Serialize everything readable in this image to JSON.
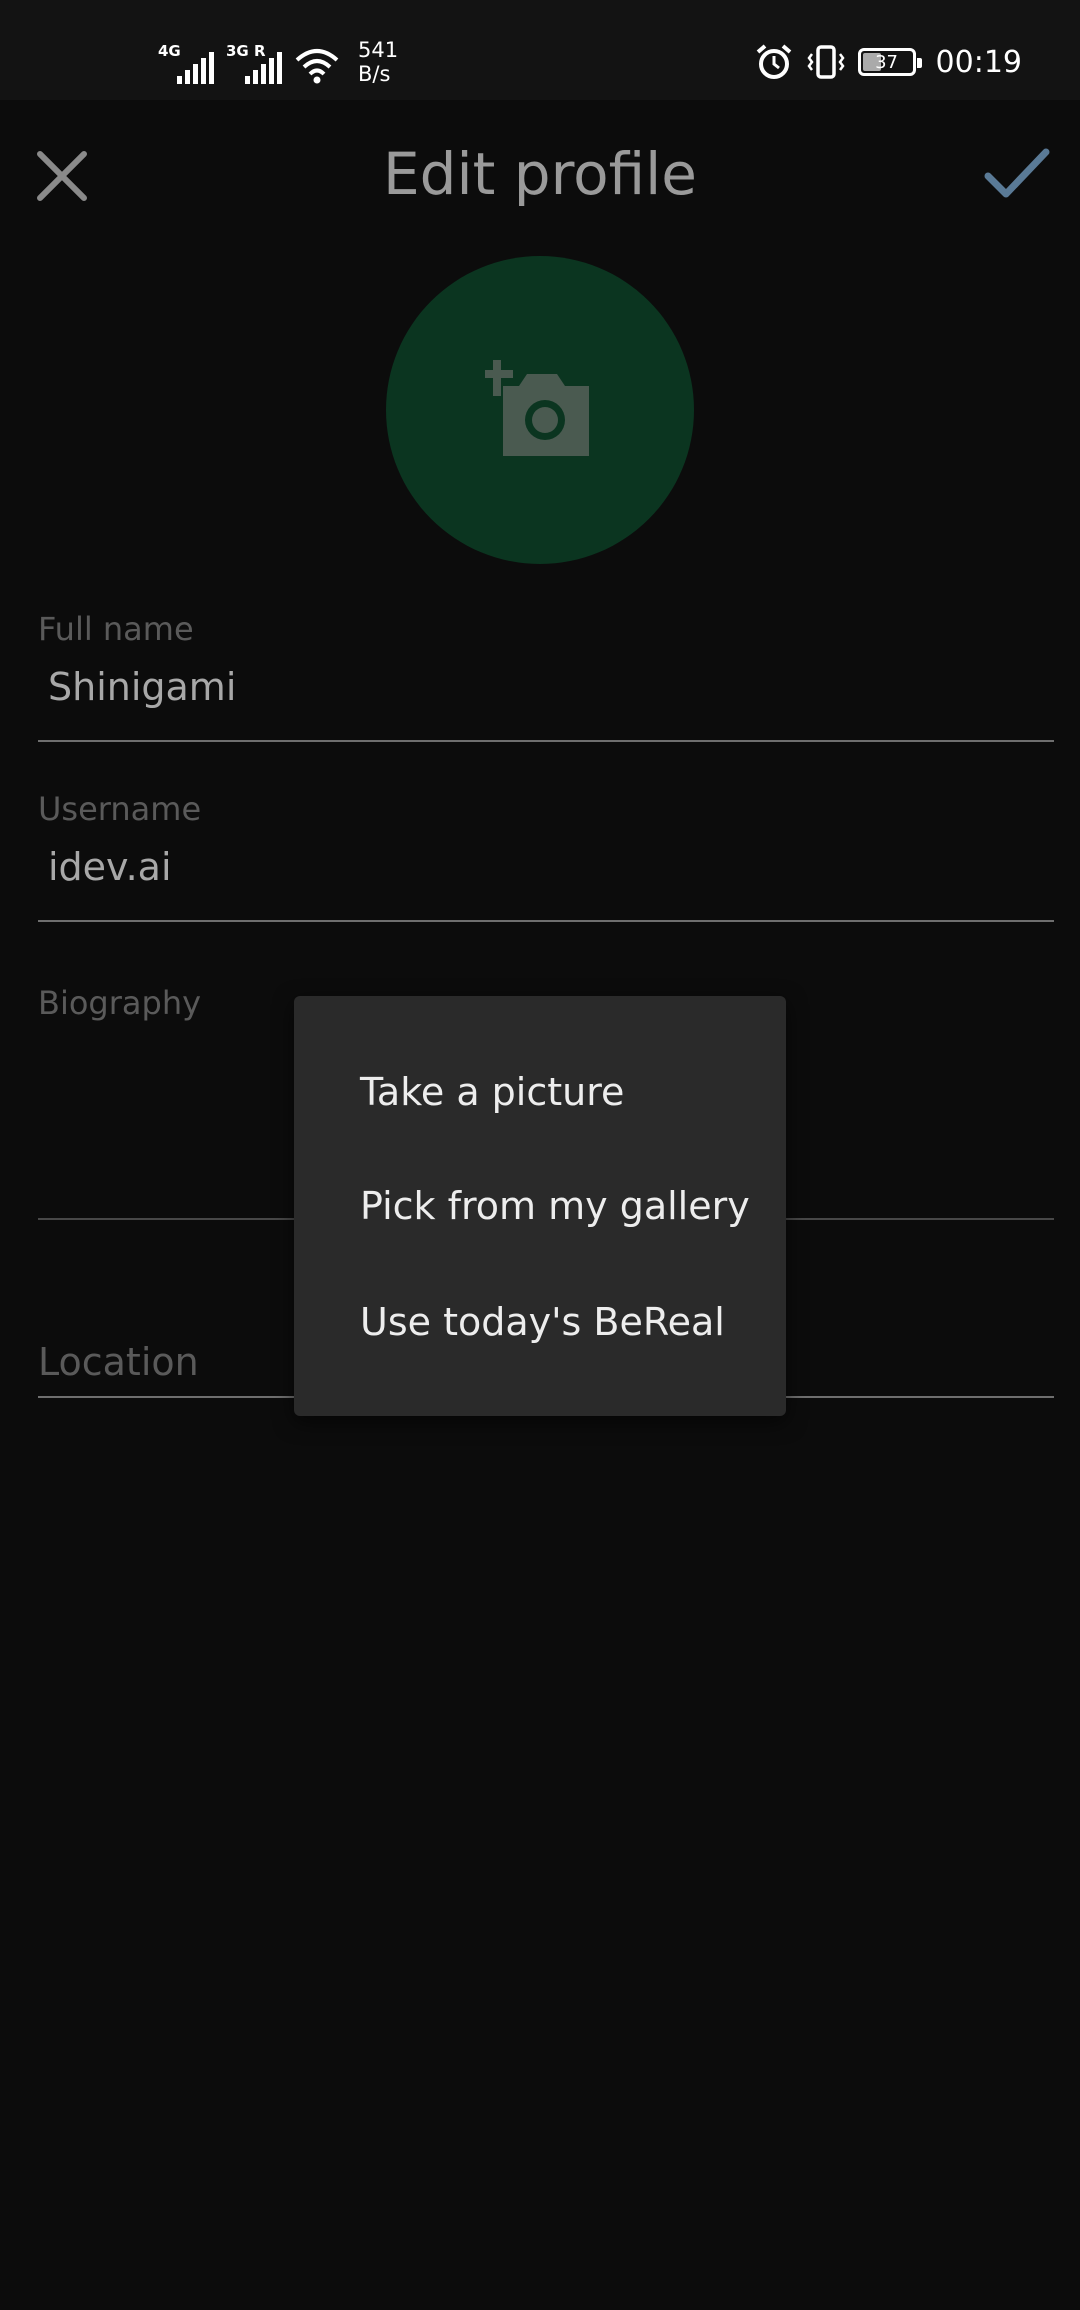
{
  "status_bar": {
    "network1": "4G",
    "network2": "3G R",
    "speed_value": "541",
    "speed_unit": "B/s",
    "battery": "37",
    "time": "00:19",
    "icons": [
      "signal-icon",
      "wifi-icon",
      "alarm-icon",
      "vibrate-icon",
      "battery-icon"
    ]
  },
  "header": {
    "title": "Edit profile",
    "close_icon": "close-icon",
    "save_icon": "check-icon"
  },
  "avatar": {
    "icon": "add-photo-icon",
    "color": "#0b3520"
  },
  "form": {
    "full_name": {
      "label": "Full name",
      "value": "Shinigami"
    },
    "username": {
      "label": "Username",
      "value": "idev.ai"
    },
    "biography": {
      "label": "Biography",
      "value": ""
    },
    "location": {
      "placeholder": "Location",
      "value": ""
    }
  },
  "photo_menu": {
    "items": [
      {
        "label": "Take a picture"
      },
      {
        "label": "Pick from my gallery"
      },
      {
        "label": "Use today's BeReal"
      }
    ]
  },
  "colors": {
    "background": "#0c0c0c",
    "menu_background": "#2a2a2a",
    "accent_check": "#5a7a96"
  }
}
